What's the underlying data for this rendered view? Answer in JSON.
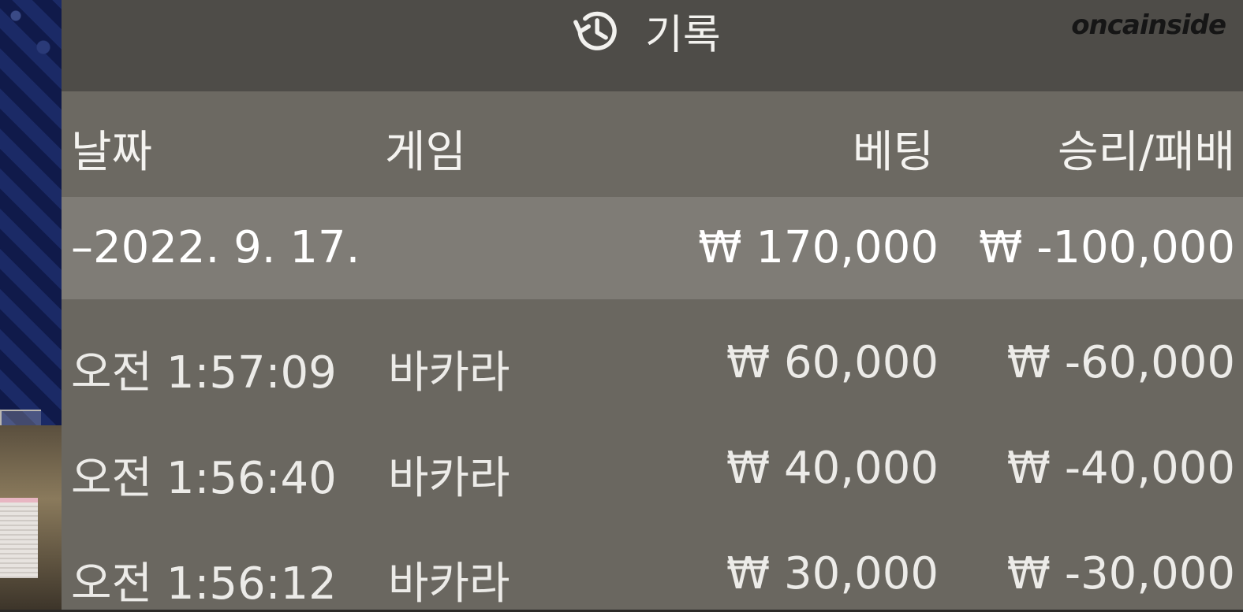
{
  "header": {
    "title": "기록",
    "icon": "history-icon"
  },
  "watermark": "oncainside",
  "columns": {
    "date": "날짜",
    "game": "게임",
    "bet": "베팅",
    "result": "승리/패배"
  },
  "summary": {
    "date": "–2022. 9. 17.",
    "bet": "₩ 170,000",
    "result": "₩ -100,000"
  },
  "rows": [
    {
      "time": "오전 1:57:09",
      "game": "바카라",
      "bet": "₩ 60,000",
      "result": "₩ -60,000"
    },
    {
      "time": "오전 1:56:40",
      "game": "바카라",
      "bet": "₩ 40,000",
      "result": "₩ -40,000"
    },
    {
      "time": "오전 1:56:12",
      "game": "바카라",
      "bet": "₩ 30,000",
      "result": "₩ -30,000"
    }
  ],
  "colors": {
    "header_bg": "#4e4c48",
    "panel_bg": "#6a6760",
    "summary_bg": "#7f7c76",
    "text": "#f2f1ee"
  }
}
